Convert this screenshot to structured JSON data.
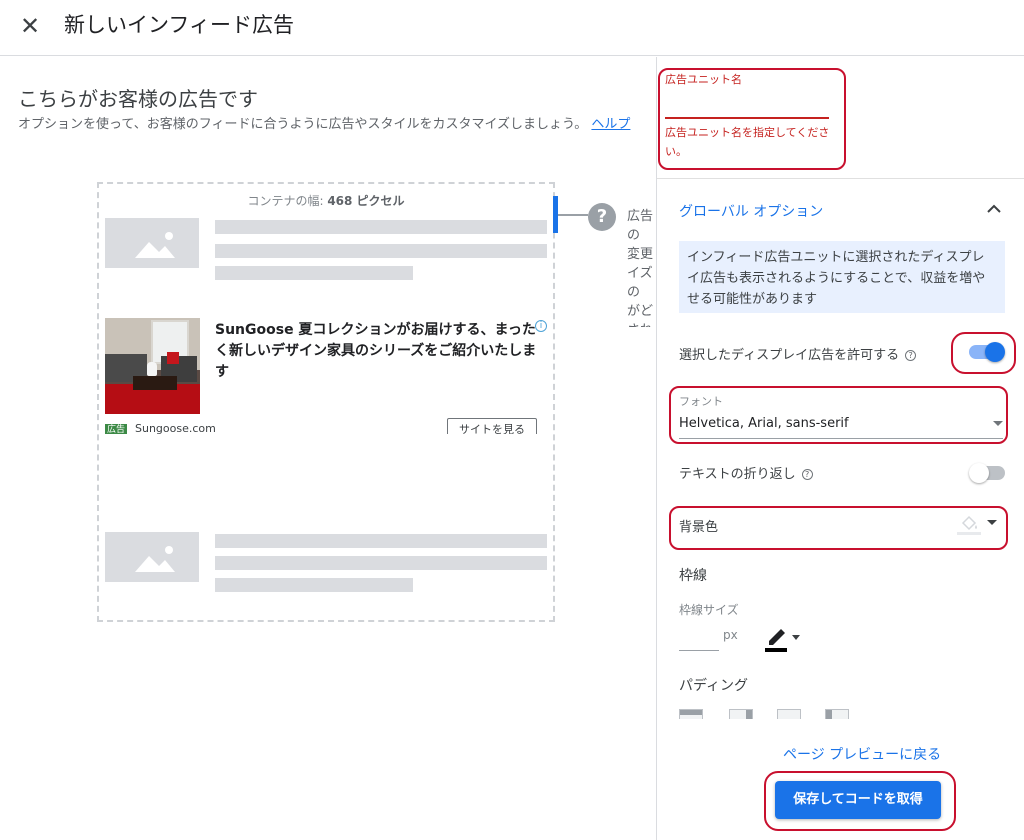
{
  "header": {
    "close_icon": "close-icon",
    "title": "新しいインフィード広告"
  },
  "main": {
    "heading": "こちらがお客様の広告です",
    "description": "オプションを使って、お客様のフィードに合うように広告やスタイルをカスタマイズしましょう。",
    "help_link": "ヘルプ",
    "container_width_label": "コンテナの幅:",
    "container_width_value": "468 ピクセル",
    "ad": {
      "headline": "SunGoose 夏コレクションがお届けする、まったく新しいデザイン家具のシリーズをご紹介いたします",
      "badge": "広告",
      "domain": "Sungoose.com",
      "cta": "サイトを見る",
      "info_icon": "info-icon"
    },
    "help_icon": "help-icon",
    "help_text": "広告の\n変更\nイズの\nがど\nされ\nす"
  },
  "sidebar": {
    "ad_unit_name_label": "広告ユニット名",
    "ad_unit_name_value": "",
    "ad_unit_name_error": "広告ユニット名を指定してください。",
    "global_options_title": "グローバル オプション",
    "chevron_icon": "chevron-up-icon",
    "notice": "インフィード広告ユニットに選択されたディスプレイ広告も表示されるようにすることで、収益を増やせる可能性があります",
    "allow_display_ads_label": "選択したディスプレイ広告を許可する",
    "allow_display_ads_on": true,
    "font_label": "フォント",
    "font_value": "Helvetica, Arial, sans-serif",
    "text_wrap_label": "テキストの折り返し",
    "text_wrap_on": false,
    "background_color_label": "背景色",
    "border_heading": "枠線",
    "border_size_label": "枠線サイズ",
    "border_size_value": "",
    "border_size_unit": "px",
    "padding_heading": "パディング",
    "back_to_preview": "ページ プレビューに戻る",
    "save_button": "保存してコードを取得"
  },
  "colors": {
    "accent": "#1a73e8",
    "error": "#c5221f",
    "highlight_box": "#c8102e",
    "ad_badge": "#3c8a46"
  }
}
